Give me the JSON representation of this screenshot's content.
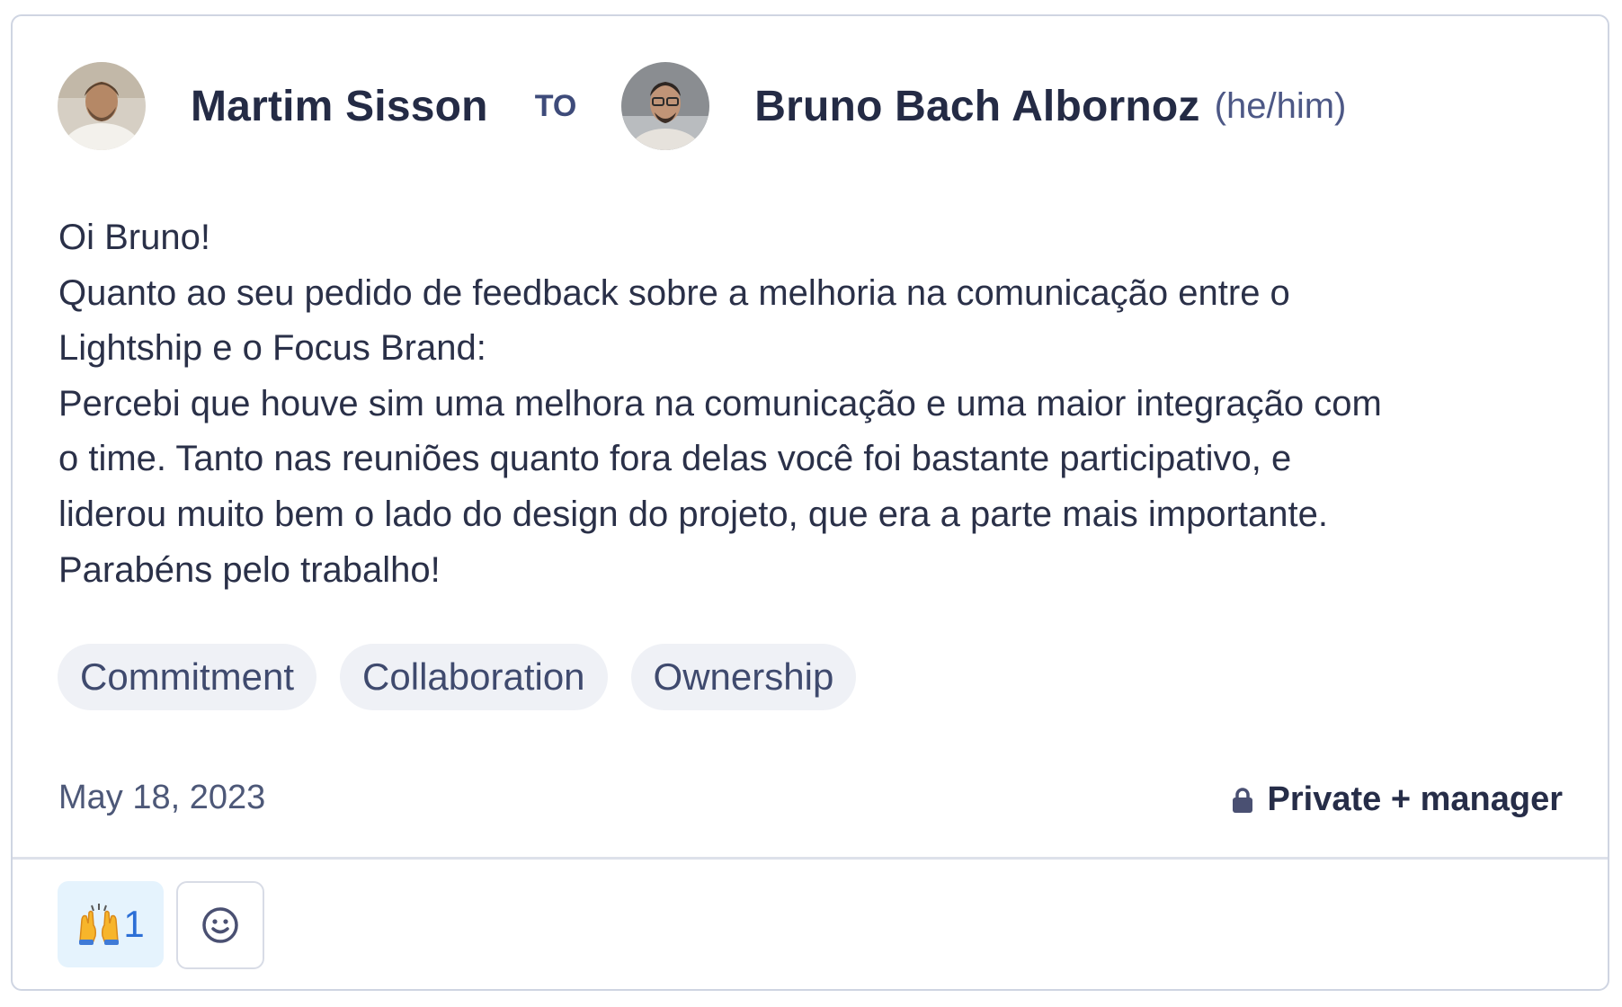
{
  "header": {
    "sender_name": "Martim Sisson",
    "connector": "TO",
    "recipient_name": "Bruno Bach Albornoz",
    "recipient_pronouns": "(he/him)"
  },
  "message": {
    "lines": [
      "Oi Bruno!",
      "Quanto ao seu pedido de feedback sobre a melhoria na comunicação entre o",
      "Lightship e o Focus Brand:",
      "Percebi que houve sim uma melhora na comunicação e uma maior integração com",
      "o time. Tanto nas reuniões quanto fora delas você foi bastante participativo, e",
      "liderou muito bem o lado do design do projeto, que era a parte mais importante.",
      "Parabéns pelo trabalho!"
    ]
  },
  "tags": [
    "Commitment",
    "Collaboration",
    "Ownership"
  ],
  "footer": {
    "date": "May 18, 2023",
    "privacy_icon": "lock-icon",
    "privacy_label": "Private + manager"
  },
  "reactions": {
    "items": [
      {
        "emoji_icon": "raising-hands-icon",
        "count": "1"
      }
    ],
    "add_reaction_icon": "smiley-icon"
  },
  "colors": {
    "card_border": "#cfd5e2",
    "tag_background": "#eff1f6",
    "reaction_background": "#e5f3fd",
    "reaction_count": "#2c6fd6",
    "accent_navy": "#3e4b7a"
  }
}
